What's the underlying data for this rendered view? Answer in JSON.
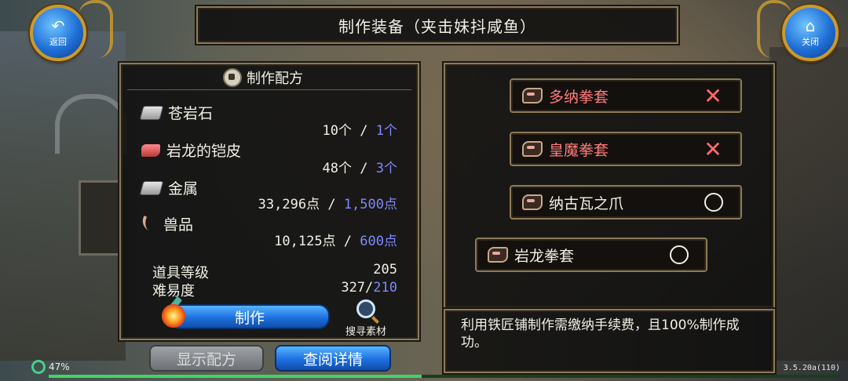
{
  "header": {
    "back_label": "返回",
    "close_label": "关闭",
    "title": "制作装备（夹击妹抖咸鱼）"
  },
  "recipe_panel": {
    "title": "制作配方",
    "materials": [
      {
        "name": "苍岩石",
        "icon": "stone-icon",
        "have": "10个",
        "sep": " / ",
        "need": "1个"
      },
      {
        "name": "岩龙的铠皮",
        "icon": "dragon-hide-icon",
        "have": "48个",
        "sep": " / ",
        "need": "3个"
      },
      {
        "name": "金属",
        "icon": "metal-icon",
        "have": "33,296点",
        "sep": " / ",
        "need": "1,500点"
      },
      {
        "name": "兽品",
        "icon": "fang-icon",
        "have": "10,125点",
        "sep": " / ",
        "need": "600点"
      }
    ],
    "item_level_label": "道具等级",
    "item_level_value": "205",
    "difficulty_label": "难易度",
    "difficulty_have": "327/",
    "difficulty_need": "210",
    "craft_label": "制作",
    "search_label": "搜寻素材"
  },
  "bottom_buttons": {
    "show_recipe": "显示配方",
    "view_detail": "查阅详情"
  },
  "recipes": [
    {
      "name": "多纳拳套",
      "status": "unavailable"
    },
    {
      "name": "皇魔拳套",
      "status": "unavailable"
    },
    {
      "name": "纳古瓦之爪",
      "status": "available"
    },
    {
      "name": "岩龙拳套",
      "status": "available"
    }
  ],
  "description": "利用铁匠铺制作需缴纳手续费，且100%制作成功。",
  "status_bar": {
    "percent": "47%",
    "progress": 0.47,
    "version": "3.5.20a(110)"
  },
  "colors": {
    "accent_blue": "#1d6fe0",
    "need_value": "#7f89ff",
    "unavailable_red": "#ff7d7d",
    "frame_gold": "#8a7a5c"
  }
}
